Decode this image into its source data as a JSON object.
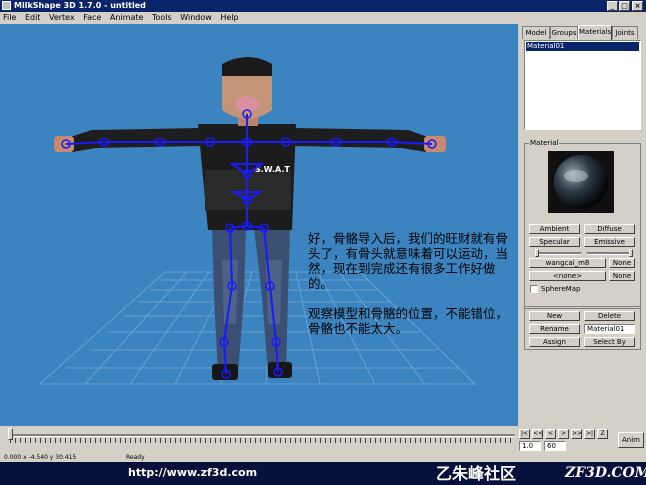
{
  "window": {
    "title": "MilkShape 3D 1.7.0 - untitled",
    "buttons": {
      "minimize": "_",
      "maximize": "□",
      "close": "×"
    }
  },
  "menu": [
    "File",
    "Edit",
    "Vertex",
    "Face",
    "Animate",
    "Tools",
    "Window",
    "Help"
  ],
  "overlay": {
    "text": "好，骨骼导入后，我们的旺财就有骨头了，有骨头就意味着可以运动，当然，现在到完成还有很多工作好做的。\n\n观察模型和骨骼的位置，不能错位，骨骼也不能太大。"
  },
  "figure": {
    "vest_label": "S.W.A.T"
  },
  "panel": {
    "tabs": [
      "Model",
      "Groups",
      "Materials",
      "Joints"
    ],
    "active_tab": "Materials",
    "materials_list": [
      "Material01"
    ],
    "material_group_label": "Material",
    "buttons": {
      "ambient": "Ambient",
      "diffuse": "Diffuse",
      "specular": "Specular",
      "emissive": "Emissive",
      "texture": "wangcai_m8",
      "texture_none": "None",
      "alpha": "<none>",
      "alpha_none": "None",
      "new": "New",
      "delete": "Delete",
      "rename": "Rename",
      "assign": "Assign",
      "select_by": "Select By"
    },
    "spheremap_label": "SphereMap",
    "rename_value": "Material01"
  },
  "timeline": {
    "nav": [
      "|<",
      "<<",
      "<",
      ">",
      ">>",
      ">|",
      "Z"
    ],
    "frame_start": "1.0",
    "frame_end": "60",
    "anim_label": "Anim"
  },
  "status": {
    "coords": "0.000 x -4.540 y 30.415",
    "ready": "Ready"
  },
  "banner": {
    "url": "http://www.zf3d.com",
    "brand": "乙朱峰社区",
    "domain": "ZF3D.COM"
  },
  "colors": {
    "viewport_bg": "#3c84c0",
    "grid": "#6ea8d6",
    "bones": "#1a1aff",
    "title_bg": "#0a246a",
    "banner_bg": "#06103a"
  }
}
